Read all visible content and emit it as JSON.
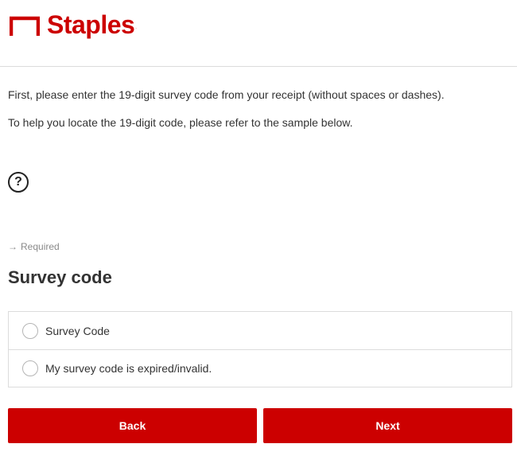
{
  "brand": {
    "name": "Staples",
    "trademark": ".",
    "color": "#cc0000",
    "logo_icon": "staples-bracket-logo"
  },
  "intro": {
    "line1": "First, please enter the 19-digit survey code from your receipt (without spaces or dashes).",
    "line2": "To help you locate the 19-digit code, please refer to the sample below."
  },
  "help": {
    "icon": "question-circle-icon",
    "symbol": "?"
  },
  "question": {
    "required_arrow": "→",
    "required_label": "Required",
    "title": "Survey code",
    "options": [
      {
        "label": "Survey Code",
        "selected": false
      },
      {
        "label": "My survey code is expired/invalid.",
        "selected": false
      }
    ]
  },
  "nav": {
    "back_label": "Back",
    "next_label": "Next",
    "button_color": "#cc0000"
  }
}
